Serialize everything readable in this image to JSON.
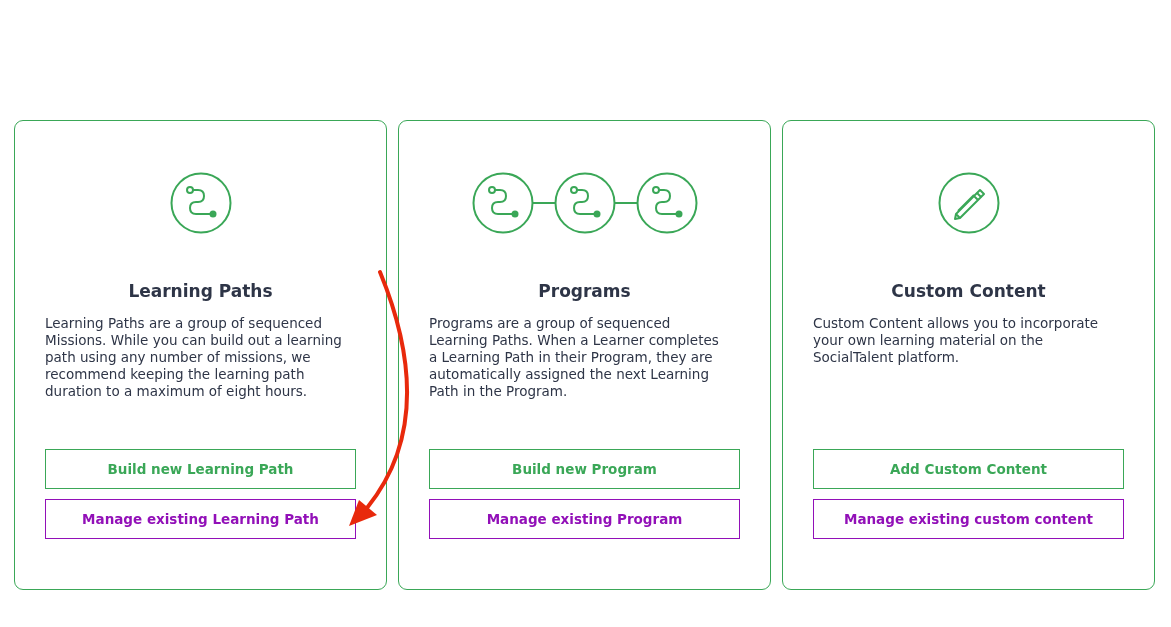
{
  "cards": [
    {
      "kind": "path",
      "title": "Learning Paths",
      "description": "Learning Paths are a group of sequenced Missions. While you can build out a learning path using any number of missions, we recommend keeping the learning path duration to a maximum of eight hours.",
      "build_button": "Build new Learning Path",
      "manage_button": "Manage existing Learning Path"
    },
    {
      "kind": "program",
      "title": "Programs",
      "description": "Programs are a group of sequenced Learning Paths. When a Learner completes a Learning Path in their Program, they are automatically assigned the next Learning Path in the Program.",
      "build_button": "Build new Program",
      "manage_button": "Manage existing Program"
    },
    {
      "kind": "custom",
      "title": "Custom Content",
      "description": "Custom Content allows you to incorporate your own learning material on the SocialTalent platform.",
      "build_button": "Add Custom Content",
      "manage_button": "Manage existing custom content"
    }
  ],
  "annotation_arrow": true
}
